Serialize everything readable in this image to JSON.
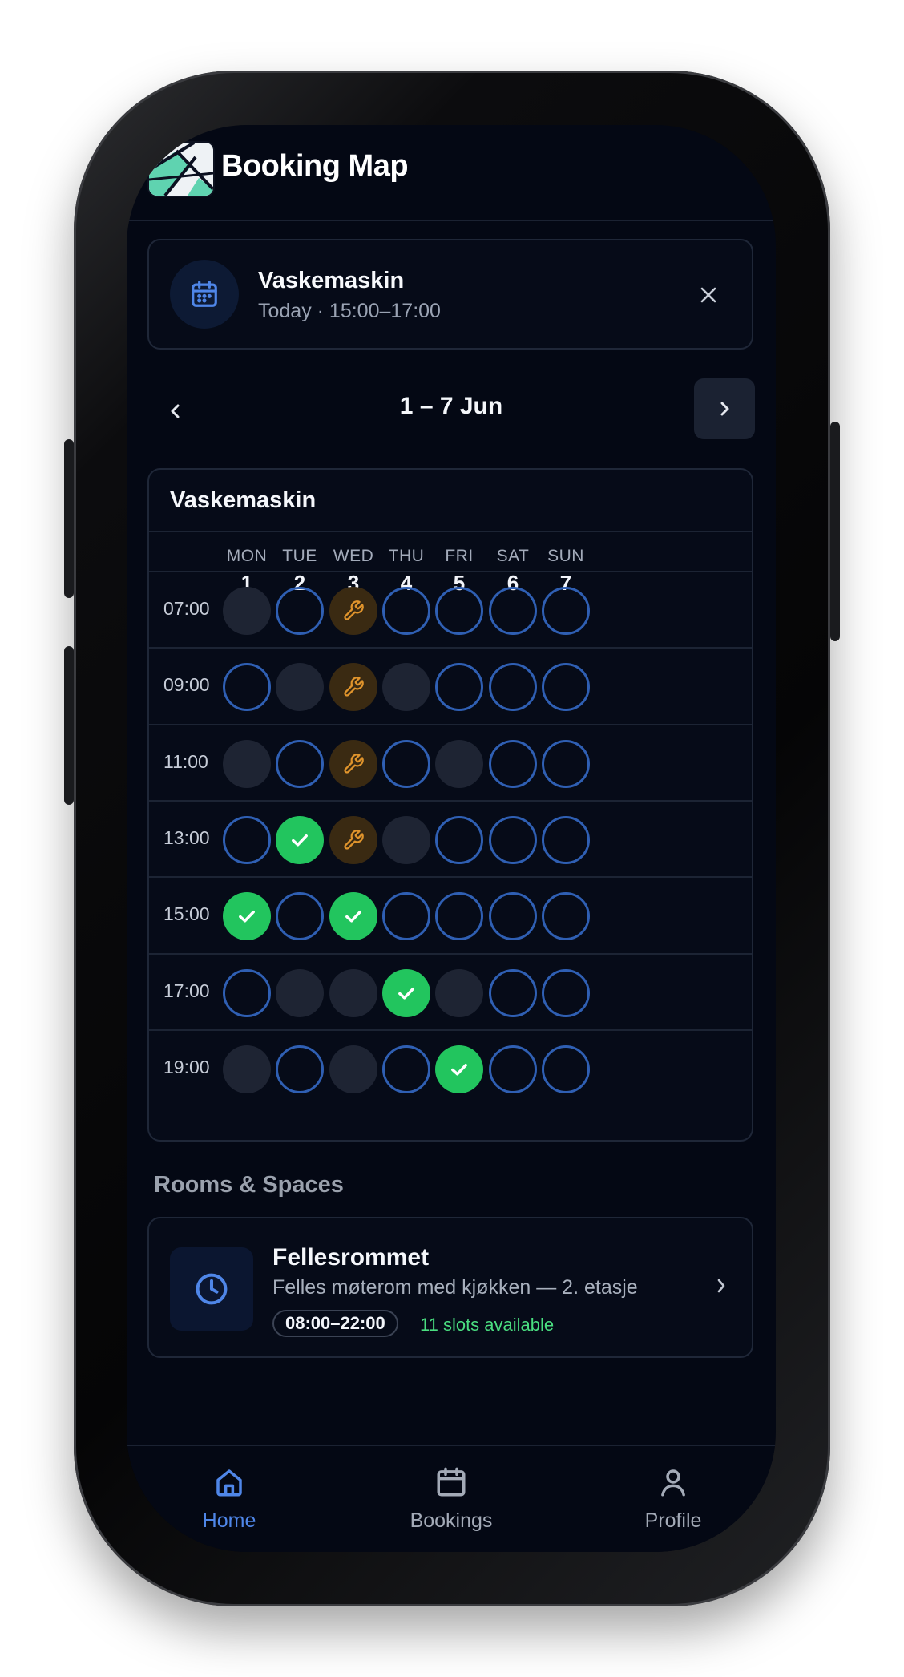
{
  "app": {
    "title": "Booking Map"
  },
  "colors": {
    "background": "#040814",
    "accent": "#3b82f6",
    "booked": "#22c55e",
    "maintenance": "#f59e0b",
    "available_ring": "#2f5fb3"
  },
  "booking": {
    "title": "Vaskemaskin",
    "subtitle": "Today · 15:00–17:00",
    "icon": "calendar-icon",
    "close_icon": "close-icon"
  },
  "week": {
    "label": "1 – 7 Jun",
    "prev_icon": "chevron-left-icon",
    "next_icon": "chevron-right-icon"
  },
  "schedule": {
    "title": "Vaskemaskin",
    "days": [
      {
        "name": "MON",
        "num": "1"
      },
      {
        "name": "TUE",
        "num": "2"
      },
      {
        "name": "WED",
        "num": "3"
      },
      {
        "name": "THU",
        "num": "4"
      },
      {
        "name": "FRI",
        "num": "5"
      },
      {
        "name": "SAT",
        "num": "6"
      },
      {
        "name": "SUN",
        "num": "7"
      }
    ],
    "rows": [
      {
        "time": "07:00",
        "slots": [
          "unavailable",
          "available",
          "maintenance",
          "available",
          "available",
          "available",
          "available"
        ]
      },
      {
        "time": "09:00",
        "slots": [
          "available",
          "unavailable",
          "maintenance",
          "unavailable",
          "available",
          "available",
          "available"
        ]
      },
      {
        "time": "11:00",
        "slots": [
          "unavailable",
          "available",
          "maintenance",
          "available",
          "unavailable",
          "available",
          "available"
        ]
      },
      {
        "time": "13:00",
        "slots": [
          "available",
          "booked",
          "maintenance",
          "unavailable",
          "available",
          "available",
          "available"
        ]
      },
      {
        "time": "15:00",
        "slots": [
          "booked",
          "available",
          "booked",
          "available",
          "available",
          "available",
          "available"
        ]
      },
      {
        "time": "17:00",
        "slots": [
          "available",
          "unavailable",
          "unavailable",
          "booked",
          "unavailable",
          "available",
          "available"
        ]
      },
      {
        "time": "19:00",
        "slots": [
          "unavailable",
          "available",
          "unavailable",
          "available",
          "booked",
          "available",
          "available"
        ]
      }
    ]
  },
  "rooms": {
    "section_title": "Rooms & Spaces",
    "items": [
      {
        "name": "Fellesrommet",
        "description": "Felles møterom med kjøkken — 2. etasje",
        "hours": "08:00–22:00",
        "availability": "11 slots available",
        "icon": "clock-icon"
      }
    ]
  },
  "bottom_nav": {
    "items": [
      {
        "label": "Home",
        "icon": "home-icon",
        "active": true
      },
      {
        "label": "Bookings",
        "icon": "calendar-icon",
        "active": false
      },
      {
        "label": "Profile",
        "icon": "user-icon",
        "active": false
      }
    ]
  }
}
